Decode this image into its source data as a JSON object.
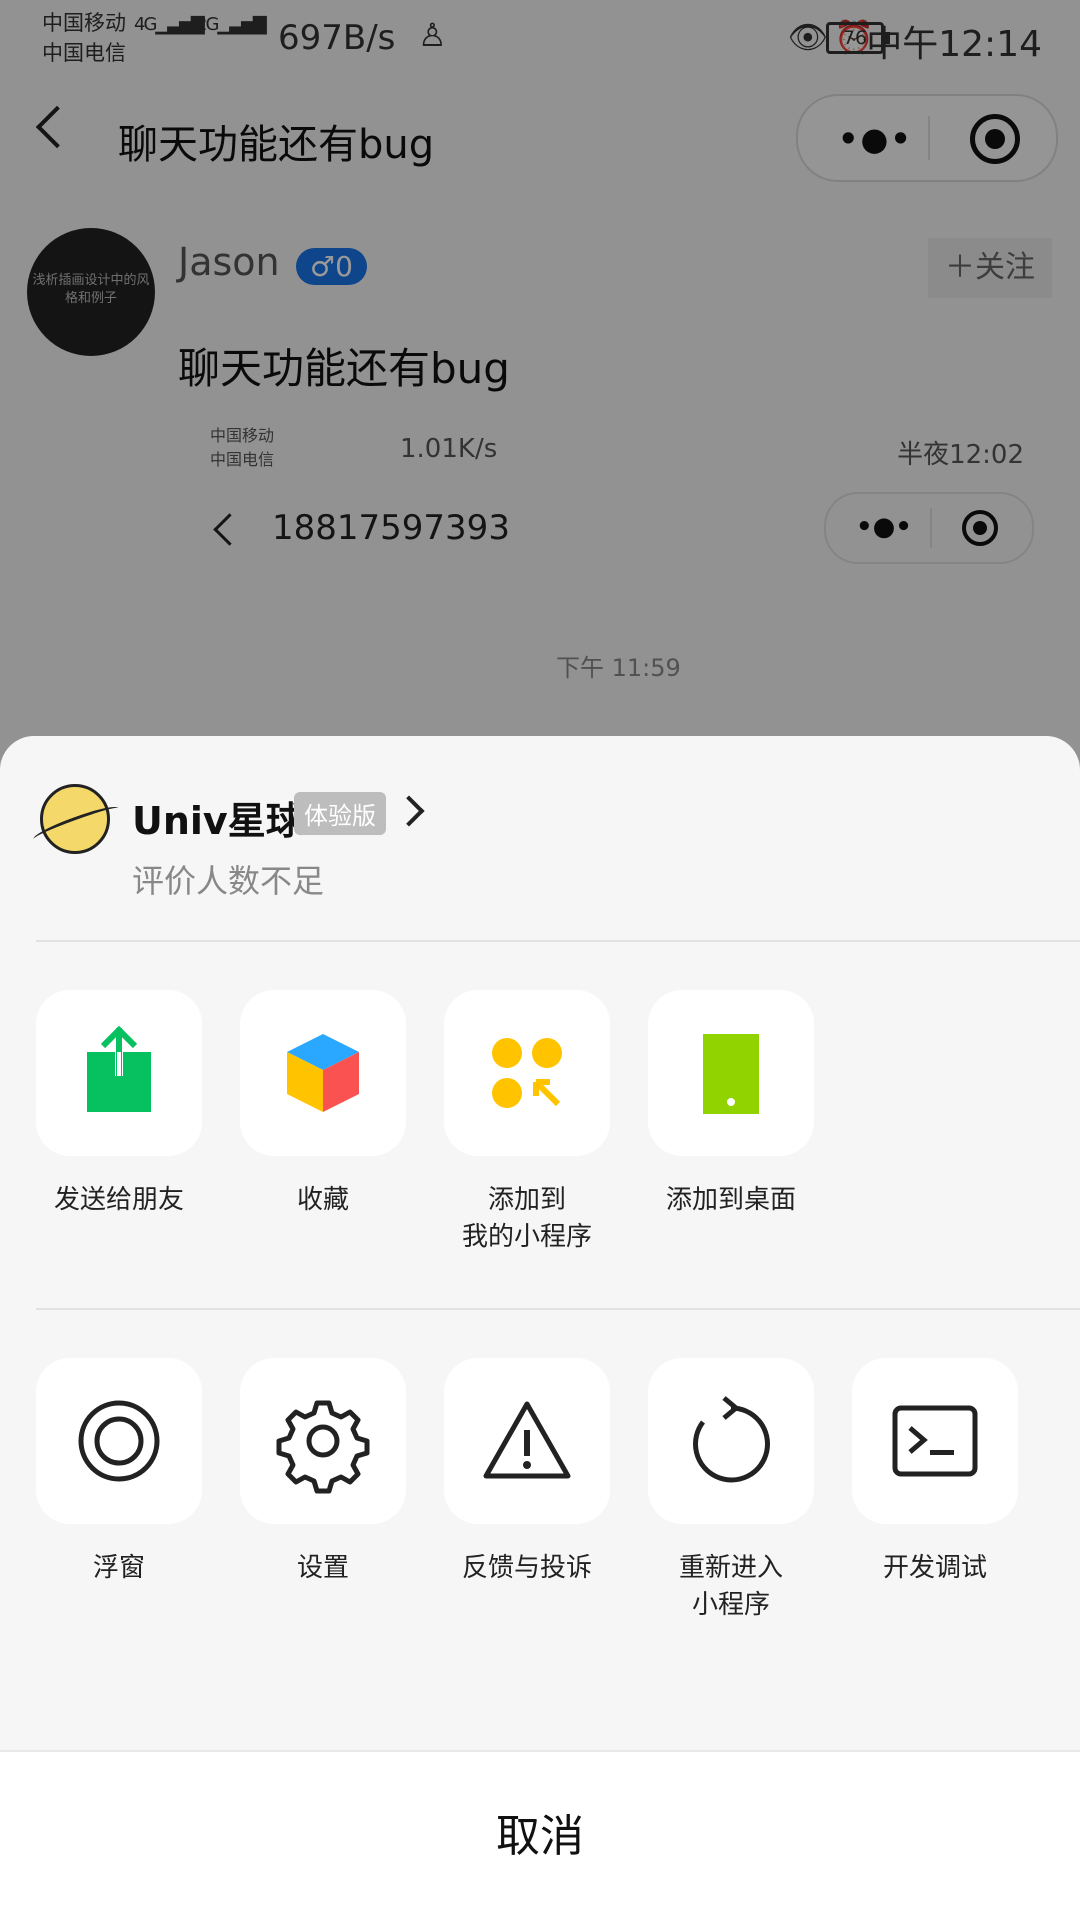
{
  "status_bar": {
    "carrier1": "中国移动",
    "carrier2": "中国电信",
    "net1": "4G",
    "net2": "2G",
    "speed": "697B/s",
    "battery": "76",
    "time": "中午12:14"
  },
  "nav": {
    "title": "聊天功能还有bug"
  },
  "post": {
    "avatar_text": "浅析插画设计中的风格和例子",
    "author": "Jason",
    "gender_badge": "♂0",
    "follow": "＋关注",
    "text": "聊天功能还有bug",
    "inner_carrier1": "中国移动",
    "inner_carrier2": "中国电信",
    "inner_speed": "1.01K/s",
    "inner_time": "半夜12:02",
    "inner_phone": "18817597393",
    "inner_chat_time": "下午 11:59"
  },
  "sheet": {
    "app_name": "Univ星球",
    "app_badge": "体验版",
    "app_rating": "评价人数不足",
    "row1": [
      {
        "label": "发送给朋友",
        "icon": "share-icon",
        "color": "#07c160"
      },
      {
        "label": "收藏",
        "icon": "favorite-cube-icon",
        "color": "#2aa7ff"
      },
      {
        "label": "添加到\n我的小程序",
        "icon": "add-to-miniprogram-icon",
        "color": "#ffc300"
      },
      {
        "label": "添加到桌面",
        "icon": "add-to-desktop-icon",
        "color": "#91d300"
      }
    ],
    "row2": [
      {
        "label": "浮窗",
        "icon": "float-window-icon"
      },
      {
        "label": "设置",
        "icon": "gear-icon"
      },
      {
        "label": "反馈与投诉",
        "icon": "warning-icon"
      },
      {
        "label": "重新进入\n小程序",
        "icon": "refresh-icon"
      },
      {
        "label": "开发调试",
        "icon": "terminal-icon"
      }
    ],
    "cancel": "取消"
  }
}
